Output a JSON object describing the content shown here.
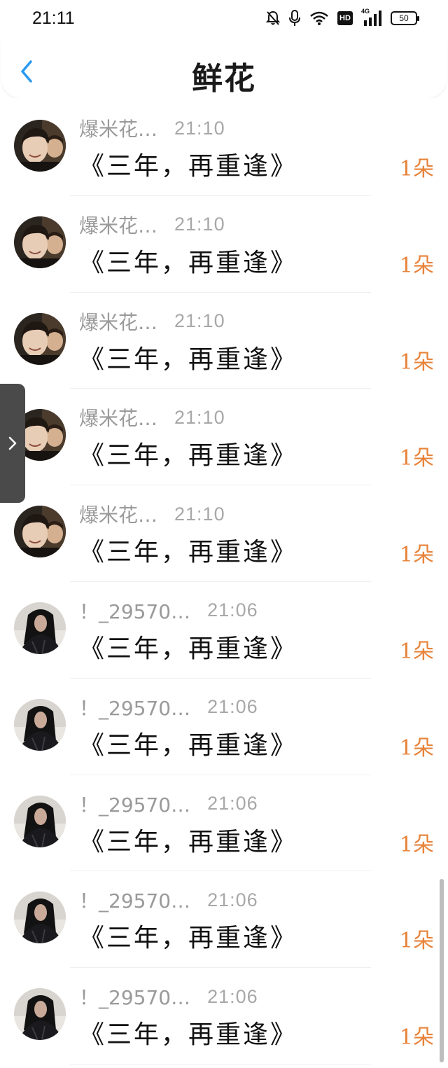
{
  "status_bar": {
    "time": "21:11",
    "hd_label": "HD",
    "network_label": "4G",
    "battery_level": "50",
    "icons": [
      "bell-off-icon",
      "microphone-icon",
      "wifi-icon",
      "hd-icon",
      "signal-icon",
      "battery-icon"
    ]
  },
  "header": {
    "title": "鲜花",
    "back_icon": "chevron-left-icon"
  },
  "colors": {
    "accent": "#2a9af0",
    "count": "#e8833a",
    "sender": "#9a9a9a",
    "time": "#a8a8a8",
    "side_tab": "#4a4a4a"
  },
  "items": [
    {
      "sender": "爆米花…",
      "time": "21:10",
      "message": "《三年，再重逢》",
      "count": "1朵",
      "avatar": "avatar-a"
    },
    {
      "sender": "爆米花…",
      "time": "21:10",
      "message": "《三年，再重逢》",
      "count": "1朵",
      "avatar": "avatar-a"
    },
    {
      "sender": "爆米花…",
      "time": "21:10",
      "message": "《三年，再重逢》",
      "count": "1朵",
      "avatar": "avatar-a"
    },
    {
      "sender": "爆米花…",
      "time": "21:10",
      "message": "《三年，再重逢》",
      "count": "1朵",
      "avatar": "avatar-a"
    },
    {
      "sender": "爆米花…",
      "time": "21:10",
      "message": "《三年，再重逢》",
      "count": "1朵",
      "avatar": "avatar-a"
    },
    {
      "sender": "！_29570…",
      "time": "21:06",
      "message": "《三年，再重逢》",
      "count": "1朵",
      "avatar": "avatar-b"
    },
    {
      "sender": "！_29570…",
      "time": "21:06",
      "message": "《三年，再重逢》",
      "count": "1朵",
      "avatar": "avatar-b"
    },
    {
      "sender": "！_29570…",
      "time": "21:06",
      "message": "《三年，再重逢》",
      "count": "1朵",
      "avatar": "avatar-b"
    },
    {
      "sender": "！_29570…",
      "time": "21:06",
      "message": "《三年，再重逢》",
      "count": "1朵",
      "avatar": "avatar-b"
    },
    {
      "sender": "！_29570…",
      "time": "21:06",
      "message": "《三年，再重逢》",
      "count": "1朵",
      "avatar": "avatar-b"
    }
  ],
  "side_tab": {
    "icon": "chevron-right-icon"
  }
}
